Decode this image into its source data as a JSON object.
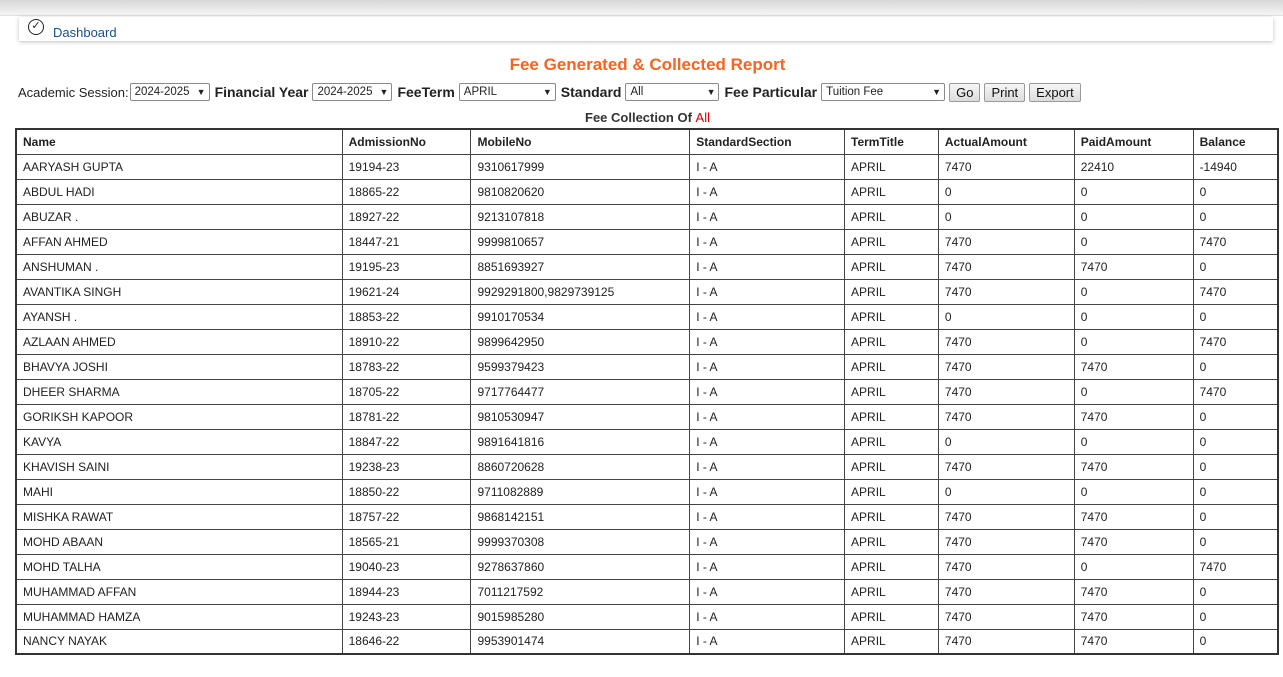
{
  "breadcrumb": {
    "label": "Dashboard"
  },
  "report_title": "Fee Generated & Collected Report",
  "filters": {
    "academic_session_label": "Academic Session:",
    "academic_session_value": "2024-2025",
    "financial_year_label": "Financial Year",
    "financial_year_value": "2024-2025",
    "fee_term_label": "FeeTerm",
    "fee_term_value": "APRIL",
    "standard_label": "Standard",
    "standard_value": "All",
    "fee_particular_label": "Fee Particular",
    "fee_particular_value": "Tuition Fee",
    "go_label": "Go",
    "print_label": "Print",
    "export_label": "Export"
  },
  "collection_heading": {
    "prefix": "Fee Collection Of",
    "value": "All"
  },
  "table": {
    "headers": [
      "Name",
      "AdmissionNo",
      "MobileNo",
      "StandardSection",
      "TermTitle",
      "ActualAmount",
      "PaidAmount",
      "Balance"
    ],
    "rows": [
      [
        "AARYASH GUPTA",
        "19194-23",
        "9310617999",
        "I - A",
        "APRIL",
        "7470",
        "22410",
        "-14940"
      ],
      [
        "ABDUL HADI",
        "18865-22",
        "9810820620",
        "I - A",
        "APRIL",
        "0",
        "0",
        "0"
      ],
      [
        "ABUZAR .",
        "18927-22",
        "9213107818",
        "I - A",
        "APRIL",
        "0",
        "0",
        "0"
      ],
      [
        "AFFAN AHMED",
        "18447-21",
        "9999810657",
        "I - A",
        "APRIL",
        "7470",
        "0",
        "7470"
      ],
      [
        "ANSHUMAN .",
        "19195-23",
        "8851693927",
        "I - A",
        "APRIL",
        "7470",
        "7470",
        "0"
      ],
      [
        "AVANTIKA SINGH",
        "19621-24",
        "9929291800,9829739125",
        "I - A",
        "APRIL",
        "7470",
        "0",
        "7470"
      ],
      [
        "AYANSH .",
        "18853-22",
        "9910170534",
        "I - A",
        "APRIL",
        "0",
        "0",
        "0"
      ],
      [
        "AZLAAN AHMED",
        "18910-22",
        "9899642950",
        "I - A",
        "APRIL",
        "7470",
        "0",
        "7470"
      ],
      [
        "BHAVYA JOSHI",
        "18783-22",
        "9599379423",
        "I - A",
        "APRIL",
        "7470",
        "7470",
        "0"
      ],
      [
        "DHEER SHARMA",
        "18705-22",
        "9717764477",
        "I - A",
        "APRIL",
        "7470",
        "0",
        "7470"
      ],
      [
        "GORIKSH KAPOOR",
        "18781-22",
        "9810530947",
        "I - A",
        "APRIL",
        "7470",
        "7470",
        "0"
      ],
      [
        "KAVYA",
        "18847-22",
        "9891641816",
        "I - A",
        "APRIL",
        "0",
        "0",
        "0"
      ],
      [
        "KHAVISH SAINI",
        "19238-23",
        "8860720628",
        "I - A",
        "APRIL",
        "7470",
        "7470",
        "0"
      ],
      [
        "MAHI",
        "18850-22",
        "9711082889",
        "I - A",
        "APRIL",
        "0",
        "0",
        "0"
      ],
      [
        "MISHKA RAWAT",
        "18757-22",
        "9868142151",
        "I - A",
        "APRIL",
        "7470",
        "7470",
        "0"
      ],
      [
        "MOHD ABAAN",
        "18565-21",
        "9999370308",
        "I - A",
        "APRIL",
        "7470",
        "7470",
        "0"
      ],
      [
        "MOHD TALHA",
        "19040-23",
        "9278637860",
        "I - A",
        "APRIL",
        "7470",
        "0",
        "7470"
      ],
      [
        "MUHAMMAD AFFAN",
        "18944-23",
        "7011217592",
        "I - A",
        "APRIL",
        "7470",
        "7470",
        "0"
      ],
      [
        "MUHAMMAD HAMZA",
        "19243-23",
        "9015985280",
        "I - A",
        "APRIL",
        "7470",
        "7470",
        "0"
      ],
      [
        "NANCY NAYAK",
        "18646-22",
        "9953901474",
        "I - A",
        "APRIL",
        "7470",
        "7470",
        "0"
      ]
    ]
  },
  "colors": {
    "title": "#f26522",
    "breadcrumb_link": "#1a4f8b",
    "all_highlight": "#e00000"
  }
}
